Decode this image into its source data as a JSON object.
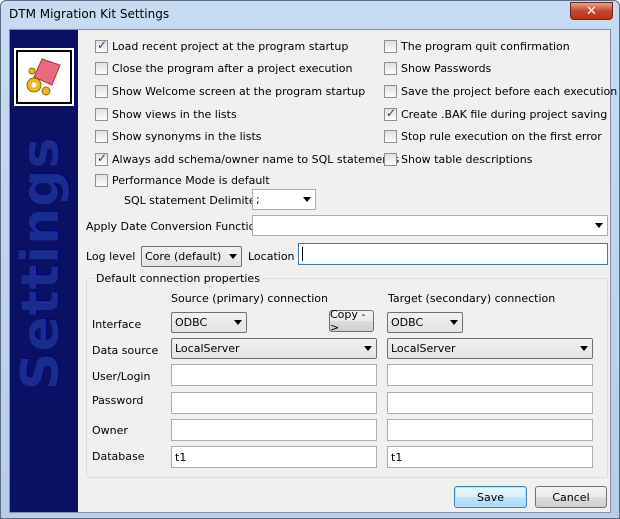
{
  "window": {
    "title": "DTM Migration Kit Settings",
    "close": "✕"
  },
  "sidebar": {
    "text": "Settings",
    "logo_icon": "wrench-and-gear-icon"
  },
  "options": {
    "left": [
      {
        "label": "Load recent project at the program startup",
        "checked": true
      },
      {
        "label": "Close the program after a project execution",
        "checked": false
      },
      {
        "label": "Show Welcome screen at the program startup",
        "checked": false
      },
      {
        "label": "Show views in the lists",
        "checked": false
      },
      {
        "label": "Show synonyms in the lists",
        "checked": false
      },
      {
        "label": "Always add schema/owner name to SQL statements",
        "checked": true
      },
      {
        "label": "Performance Mode is default",
        "checked": false
      }
    ],
    "right": [
      {
        "label": "The program quit confirmation",
        "checked": false
      },
      {
        "label": "Show Passwords",
        "checked": false
      },
      {
        "label": "Save the project before each execution",
        "checked": false
      },
      {
        "label": "Create .BAK file during project saving",
        "checked": true
      },
      {
        "label": "Stop rule execution on the first error",
        "checked": false
      },
      {
        "label": "Show table descriptions",
        "checked": false
      }
    ]
  },
  "sql_delimiter": {
    "label": "SQL statement Delimiter",
    "value": ";"
  },
  "date_conversion": {
    "label": "Apply Date Conversion Function",
    "value": ""
  },
  "log": {
    "label": "Log level",
    "value": "Core (default)",
    "location_label": "Location",
    "location_value": ""
  },
  "connections": {
    "group_title": "Default connection properties",
    "source_header": "Source (primary) connection",
    "target_header": "Target (secondary) connection",
    "copy_button": "Copy ->",
    "interface_label": "Interface",
    "data_source_label": "Data source",
    "user_label": "User/Login",
    "password_label": "Password",
    "owner_label": "Owner",
    "database_label": "Database",
    "source": {
      "interface": "ODBC",
      "data_source": "LocalServer",
      "user": "",
      "password": "",
      "owner": "",
      "database": "t1"
    },
    "target": {
      "interface": "ODBC",
      "data_source": "LocalServer",
      "user": "",
      "password": "",
      "owner": "",
      "database": "t1"
    }
  },
  "buttons": {
    "save": "Save",
    "cancel": "Cancel"
  }
}
